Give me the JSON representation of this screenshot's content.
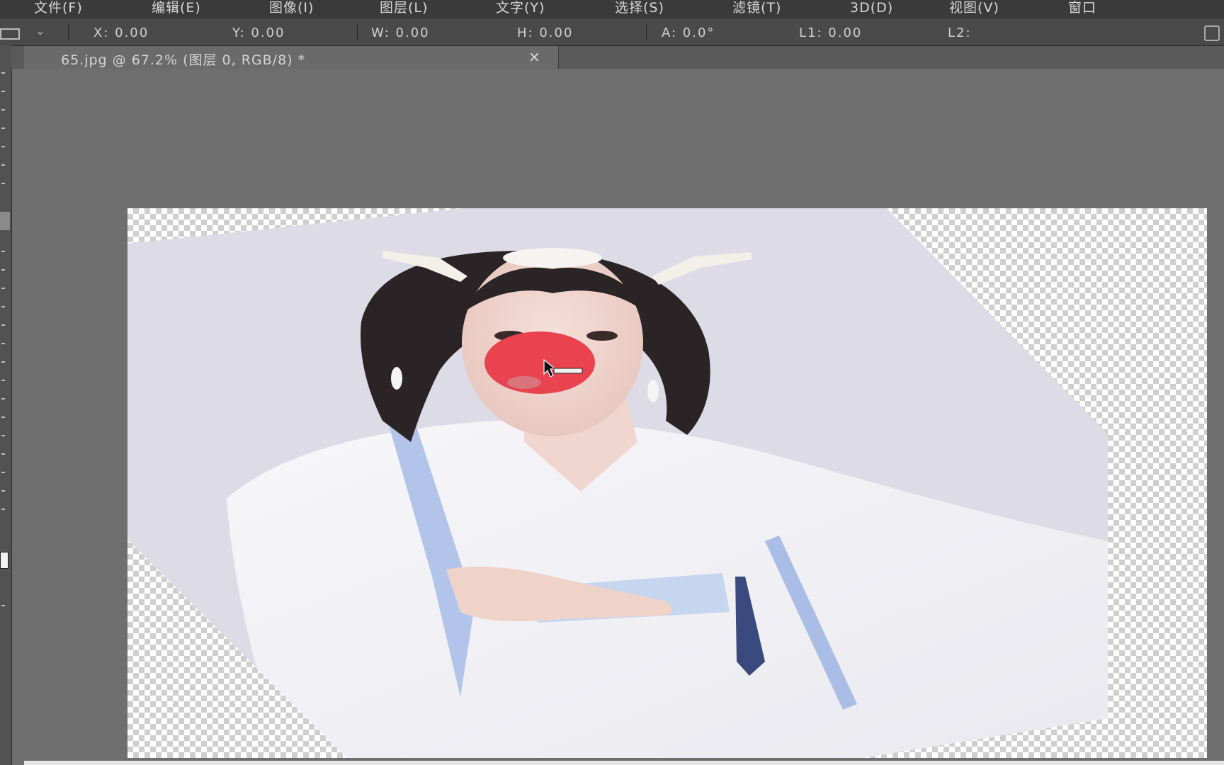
{
  "menu": {
    "items": [
      "文件(F)",
      "编辑(E)",
      "图像(I)",
      "图层(L)",
      "文字(Y)",
      "选择(S)",
      "滤镜(T)",
      "3D(D)",
      "视图(V)",
      "窗口"
    ]
  },
  "options_bar": {
    "x": "X: 0.00",
    "y": "Y: 0.00",
    "w": "W: 0.00",
    "h": "H: 0.00",
    "a": "A: 0.0°",
    "l1": "L1: 0.00",
    "l2": "L2:"
  },
  "document": {
    "tab_title": "65.jpg @ 67.2% (图层 0, RGB/8) *",
    "close_glyph": "×"
  },
  "colors": {
    "app_bg": "#6f6f6f",
    "menubar_bg": "#3a3a3a",
    "nose_red": "#e8434f",
    "robe_blue": "#a9bde6",
    "photo_bg": "#dddce6"
  },
  "icons": {
    "preset": "marquee-preset-icon",
    "chevron": "chevron-down-icon",
    "close": "close-icon",
    "cursor": "arrow-cursor-icon"
  }
}
